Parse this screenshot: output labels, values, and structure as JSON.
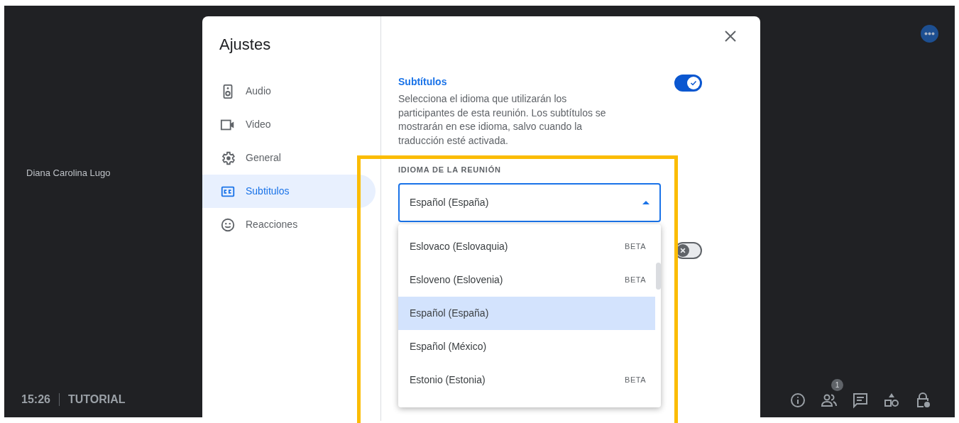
{
  "meeting": {
    "participant_name": "Diana Carolina Lugo",
    "time": "15:26",
    "meeting_title": "TUTORIAL",
    "badge": "1"
  },
  "dialog": {
    "title": "Ajustes",
    "nav": [
      {
        "label": "Audio",
        "kind": "speaker",
        "selected": false
      },
      {
        "label": "Video",
        "kind": "camera",
        "selected": false
      },
      {
        "label": "General",
        "kind": "gear",
        "selected": false
      },
      {
        "label": "Subtitulos",
        "kind": "cc",
        "selected": true
      },
      {
        "label": "Reacciones",
        "kind": "smile",
        "selected": false
      }
    ],
    "section": {
      "title": "Subtítulos",
      "description": "Selecciona el idioma que utilizarán los participantes de esta reunión. Los subtítulos se mostrarán en ese idioma, salvo cuando la traducción esté activada.",
      "on": true
    },
    "second_toggle": {
      "on": false
    },
    "language": {
      "label": "IDIOMA DE LA REUNIÓN",
      "value": "Español (España)",
      "expanded": true,
      "options": [
        {
          "label": "Eslovaco (Eslovaquia)",
          "tag": "BETA",
          "selected": false
        },
        {
          "label": "Esloveno (Eslovenia)",
          "tag": "BETA",
          "selected": false
        },
        {
          "label": "Español (España)",
          "selected": true
        },
        {
          "label": "Español (México)",
          "selected": false
        },
        {
          "label": "Estonio (Estonia)",
          "tag": "BETA",
          "selected": false
        }
      ]
    }
  }
}
